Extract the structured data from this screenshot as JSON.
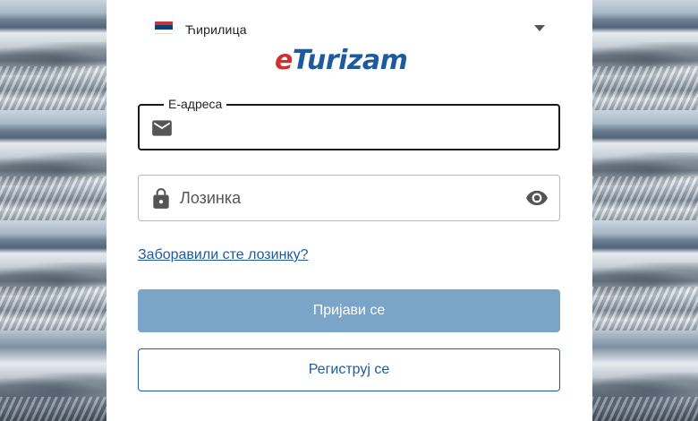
{
  "language": {
    "label": "Ћирилица",
    "flag_colors": [
      "#c6363c",
      "#0c4076",
      "#ffffff"
    ]
  },
  "logo": {
    "prefix": "e",
    "rest": "Turizam",
    "prefix_color": "#d32f2f",
    "rest_color": "#1e5a9e"
  },
  "email_field": {
    "label": "Е-адреса",
    "value": "",
    "icon": "mail-icon"
  },
  "password_field": {
    "placeholder": "Лозинка",
    "value": "",
    "icon": "lock-icon",
    "toggle_icon": "eye-icon"
  },
  "forgot_link": "Заборавили сте лозинку?",
  "login_button": "Пријави се",
  "register_button": "Региструј се",
  "colors": {
    "accent": "#1e5a9e",
    "login_button_bg": "#7ba4c9"
  }
}
